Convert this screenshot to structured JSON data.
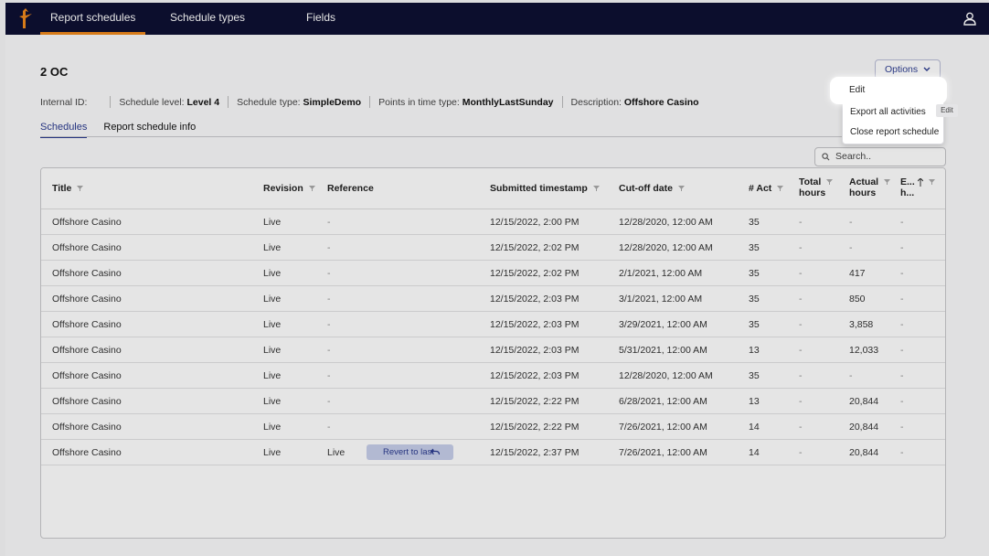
{
  "nav": {
    "tabs": [
      {
        "label": "Report schedules"
      },
      {
        "label": "Schedule types"
      },
      {
        "label": "Fields"
      }
    ]
  },
  "icons": {
    "logo": "logo-icon",
    "user": "user-icon",
    "search": "search-icon",
    "filter": "filter-icon",
    "sort": "sort-arrow-icon",
    "undo": "undo-icon"
  },
  "colors": {
    "nav_bg": "#0e1033",
    "nav_accent": "#f08a1c",
    "primary": "#2a3a8f",
    "revert_bg": "#c7cfea"
  },
  "schedule": {
    "title": "2 OC",
    "internal_id_label": "Internal ID:",
    "level_label": "Schedule level:",
    "level_value": "Level 4",
    "type_label": "Schedule type:",
    "type_value": "SimpleDemo",
    "points_label": "Points in time type:",
    "points_value": "MonthlyLastSunday",
    "description_label": "Description:",
    "description_value": "Offshore Casino"
  },
  "subtabs": [
    {
      "label": "Schedules"
    },
    {
      "label": "Report schedule info"
    }
  ],
  "options": {
    "label": "Options",
    "menu": [
      {
        "label": "Edit"
      },
      {
        "label": "Export all activities"
      },
      {
        "label": "Close report schedule"
      }
    ],
    "tooltip": "Edit"
  },
  "search": {
    "placeholder": "Search.."
  },
  "table": {
    "headers": {
      "title": "Title",
      "revision": "Revision",
      "reference": "Reference",
      "submitted": "Submitted timestamp",
      "cutoff": "Cut-off date",
      "act": "# Act",
      "total_hours_1": "Total",
      "total_hours_2": "hours",
      "actual_hours_1": "Actual",
      "actual_hours_2": "hours",
      "e_hours_1": "E...",
      "e_hours_2": "h..."
    },
    "revert_label": "Revert to last",
    "rows": [
      {
        "title": "Offshore Casino",
        "revision": "Live",
        "reference": "-",
        "submitted": "12/15/2022, 2:00 PM",
        "cutoff": "12/28/2020, 12:00 AM",
        "act": "35",
        "total": "-",
        "actual": "-",
        "e": "-"
      },
      {
        "title": "Offshore Casino",
        "revision": "Live",
        "reference": "-",
        "submitted": "12/15/2022, 2:02 PM",
        "cutoff": "12/28/2020, 12:00 AM",
        "act": "35",
        "total": "-",
        "actual": "-",
        "e": "-"
      },
      {
        "title": "Offshore Casino",
        "revision": "Live",
        "reference": "-",
        "submitted": "12/15/2022, 2:02 PM",
        "cutoff": "2/1/2021, 12:00 AM",
        "act": "35",
        "total": "-",
        "actual": "417",
        "e": "-"
      },
      {
        "title": "Offshore Casino",
        "revision": "Live",
        "reference": "-",
        "submitted": "12/15/2022, 2:03 PM",
        "cutoff": "3/1/2021, 12:00 AM",
        "act": "35",
        "total": "-",
        "actual": "850",
        "e": "-"
      },
      {
        "title": "Offshore Casino",
        "revision": "Live",
        "reference": "-",
        "submitted": "12/15/2022, 2:03 PM",
        "cutoff": "3/29/2021, 12:00 AM",
        "act": "35",
        "total": "-",
        "actual": "3,858",
        "e": "-"
      },
      {
        "title": "Offshore Casino",
        "revision": "Live",
        "reference": "-",
        "submitted": "12/15/2022, 2:03 PM",
        "cutoff": "5/31/2021, 12:00 AM",
        "act": "13",
        "total": "-",
        "actual": "12,033",
        "e": "-"
      },
      {
        "title": "Offshore Casino",
        "revision": "Live",
        "reference": "-",
        "submitted": "12/15/2022, 2:03 PM",
        "cutoff": "12/28/2020, 12:00 AM",
        "act": "35",
        "total": "-",
        "actual": "-",
        "e": "-"
      },
      {
        "title": "Offshore Casino",
        "revision": "Live",
        "reference": "-",
        "submitted": "12/15/2022, 2:22 PM",
        "cutoff": "6/28/2021, 12:00 AM",
        "act": "13",
        "total": "-",
        "actual": "20,844",
        "e": "-"
      },
      {
        "title": "Offshore Casino",
        "revision": "Live",
        "reference": "-",
        "submitted": "12/15/2022, 2:22 PM",
        "cutoff": "7/26/2021, 12:00 AM",
        "act": "14",
        "total": "-",
        "actual": "20,844",
        "e": "-"
      },
      {
        "title": "Offshore Casino",
        "revision": "Live",
        "reference": "Live",
        "submitted": "12/15/2022, 2:37 PM",
        "cutoff": "7/26/2021, 12:00 AM",
        "act": "14",
        "total": "-",
        "actual": "20,844",
        "e": "-"
      }
    ]
  }
}
